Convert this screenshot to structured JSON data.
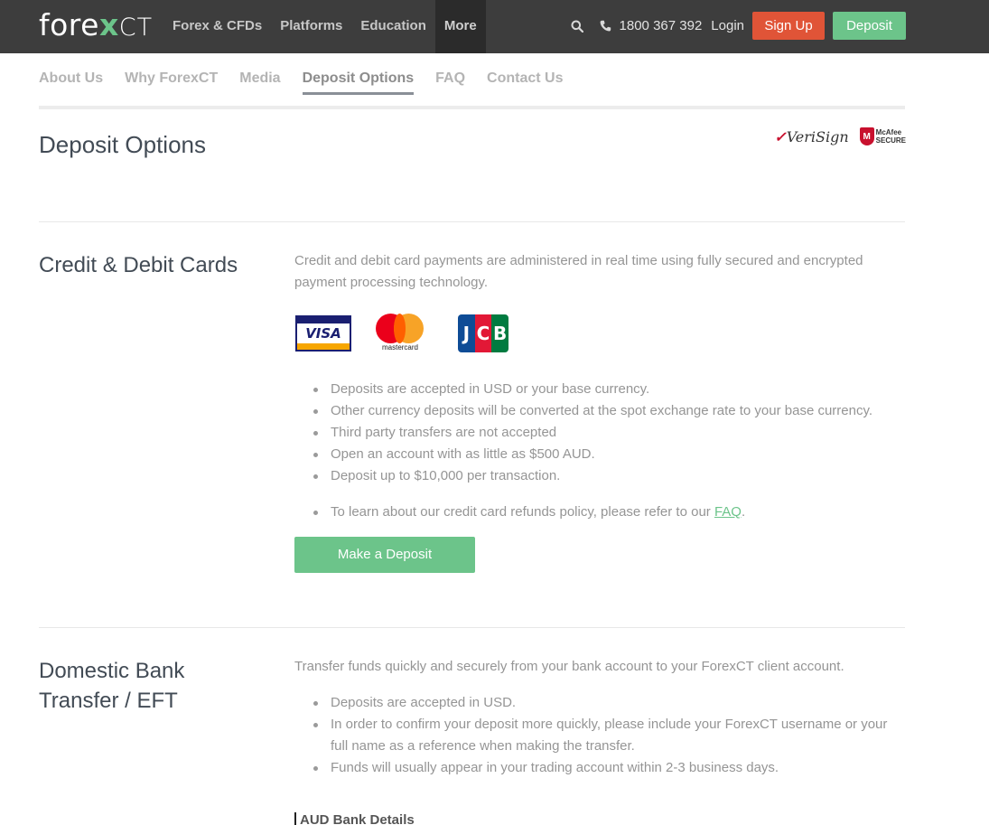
{
  "header": {
    "logo": {
      "forex": "fore",
      "x": "x",
      "ct": "CT"
    },
    "nav": [
      "Forex & CFDs",
      "Platforms",
      "Education",
      "More"
    ],
    "icons": {
      "search": "search-icon",
      "phone": "phone-icon"
    },
    "phone": "1800 367 392",
    "login": "Login",
    "signup": "Sign Up",
    "deposit": "Deposit"
  },
  "subnav": [
    "About Us",
    "Why ForexCT",
    "Media",
    "Deposit Options",
    "FAQ",
    "Contact Us"
  ],
  "page_title": "Deposit Options",
  "seals": {
    "verisign": "VeriSign",
    "mcafee_line1": "McAfee",
    "mcafee_line2": "SECURE"
  },
  "cards_section": {
    "heading": "Credit & Debit Cards",
    "description": "Credit and debit card payments are administered in real time using fully secured and encrypted payment processing technology.",
    "card_logos": [
      "VISA",
      "mastercard",
      "JCB"
    ],
    "bullets": [
      "Deposits are accepted in USD or your base currency.",
      "Other currency deposits will be converted at the spot exchange rate to your base currency.",
      "Third party transfers are not accepted",
      "Open an account with as little as $500 AUD.",
      "Deposit up to $10,000 per transaction."
    ],
    "refund_prefix": "To learn about our credit card refunds policy, please refer to our ",
    "refund_link": "FAQ",
    "refund_suffix": ".",
    "button": "Make a Deposit"
  },
  "bank_section": {
    "heading_line1": "Domestic Bank",
    "heading_line2": "Transfer / EFT",
    "description": "Transfer funds quickly and securely from your bank account to your ForexCT client account.",
    "bullets": [
      "Deposits are accepted in USD.",
      "In order to confirm your deposit more quickly, please include your ForexCT username or your full name as a reference when making the transfer.",
      "Funds will usually appear in your trading account within 2-3 business days."
    ],
    "sub_heading": "AUD Bank Details"
  },
  "colors": {
    "topbar": "#3d3d3d",
    "accent_green": "#6cc48a",
    "signup_red": "#e05437"
  }
}
